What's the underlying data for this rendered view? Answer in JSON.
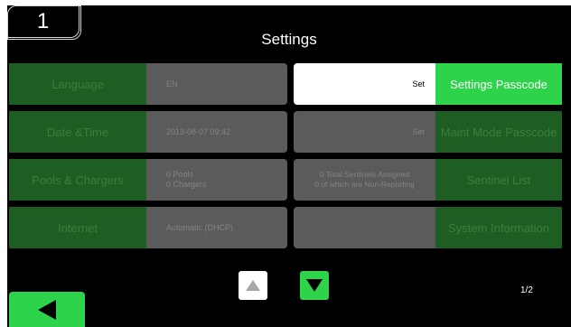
{
  "header": {
    "screen_number": "1",
    "title": "Settings"
  },
  "rows": [
    {
      "label": "Language",
      "value": "EN"
    },
    {
      "label": "Date &Time",
      "value": "2013-08-07  09:42"
    },
    {
      "label": "Pools & Chargers",
      "value_line1": "0 Pools",
      "value_line2": "0 Chargers"
    },
    {
      "label": "Internet",
      "value": "Automatic (DHCP)"
    }
  ],
  "right_rows": [
    {
      "value": "Set",
      "label": "Settings Passcode"
    },
    {
      "value": "Set",
      "label": "Maint Mode Passcode"
    },
    {
      "value_line1": "0 Total Sentinels Assigned",
      "value_line2": "0 of which are Non-Reporting",
      "label": "Sentinel List"
    },
    {
      "value": "",
      "label": "System Information"
    }
  ],
  "footer": {
    "page_indicator": "1/2"
  },
  "colors": {
    "bright_green": "#2ed34c",
    "dim_green": "#1e5e22",
    "dim_gray": "#5b5b5b",
    "panel": "#000000"
  },
  "icons": {
    "up": "triangle-up-icon",
    "down": "triangle-down-icon",
    "back": "triangle-left-icon"
  }
}
